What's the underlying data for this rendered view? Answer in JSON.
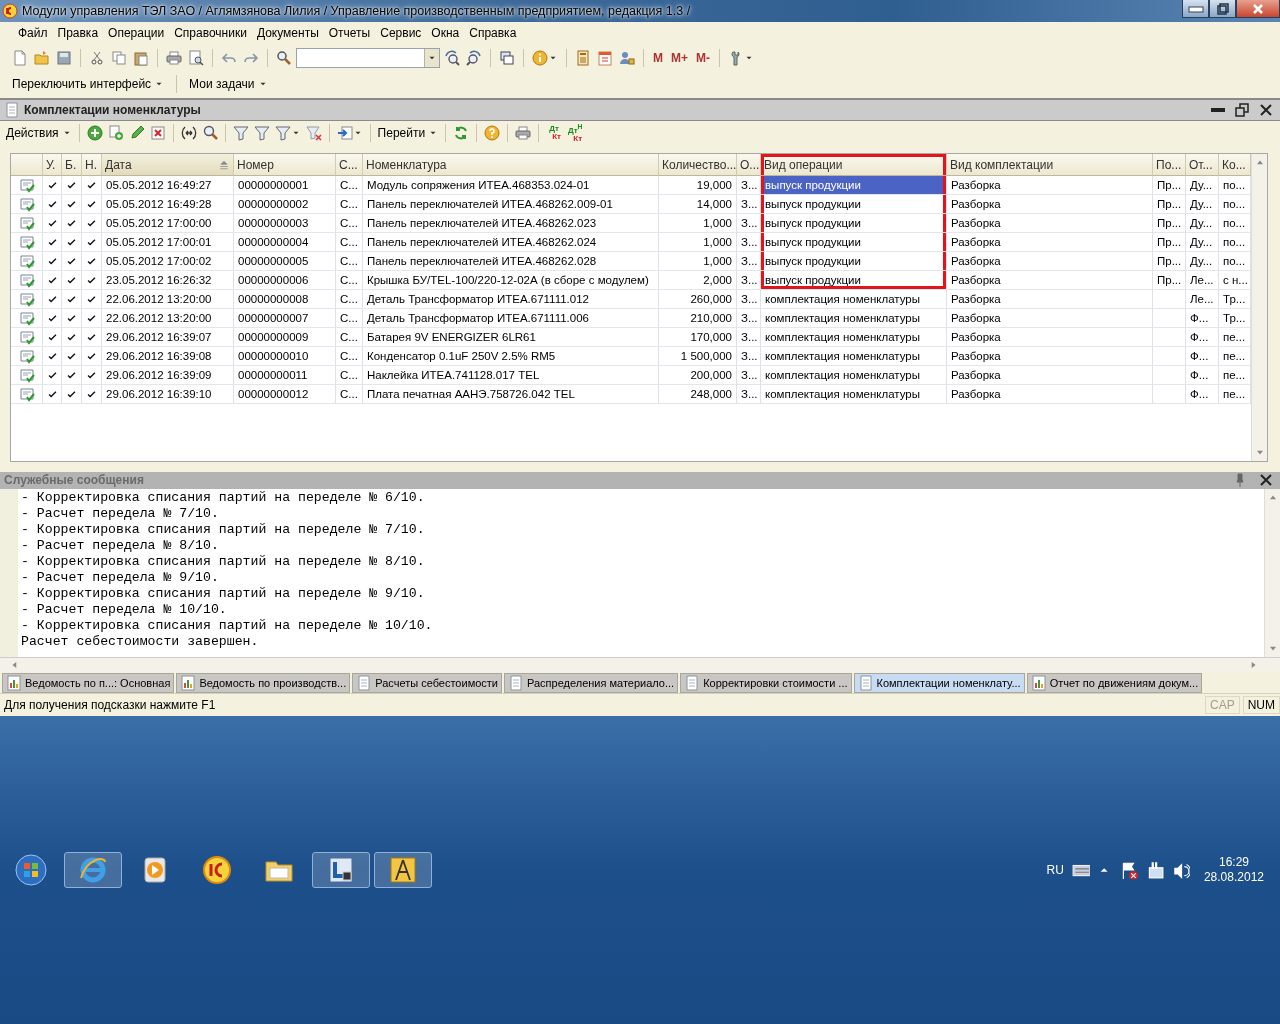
{
  "window": {
    "title": "Модули управления ТЭЛ ЗАО / Аглямзянова Лилия /  Управление производственным предприятием, редакция 1.3 /"
  },
  "menu": [
    "Файл",
    "Правка",
    "Операции",
    "Справочники",
    "Документы",
    "Отчеты",
    "Сервис",
    "Окна",
    "Справка"
  ],
  "toolbar": {
    "memory_buttons": [
      "M",
      "M+",
      "M-"
    ]
  },
  "panel_bar": [
    {
      "label": "Переключить интерфейс",
      "dropdown": true
    },
    {
      "label": "Мои задачи",
      "dropdown": true
    }
  ],
  "document": {
    "title": "Комплектации номенклатуры",
    "actions": "Действия",
    "goto": "Перейти",
    "ledger_buttons": [
      {
        "debit": "Дт",
        "credit": "Кт"
      },
      {
        "debit": "Дт$^{Н}$",
        "credit": "Кт"
      }
    ]
  },
  "table": {
    "check_columns": [
      {
        "label": "У."
      },
      {
        "label": "Б."
      },
      {
        "label": "Н."
      }
    ],
    "columns": [
      {
        "label": "Дата",
        "kind": "text",
        "sorted": true,
        "current": false,
        "framed": false
      },
      {
        "label": "Номер",
        "kind": "text",
        "sorted": false,
        "current": false,
        "framed": false
      },
      {
        "label": "С...",
        "kind": "text",
        "sorted": false,
        "current": false,
        "framed": false
      },
      {
        "label": "Номенклатура",
        "kind": "text",
        "sorted": false,
        "current": false,
        "framed": false
      },
      {
        "label": "Количество...",
        "kind": "number",
        "sorted": false,
        "current": false,
        "framed": false
      },
      {
        "label": "О...",
        "kind": "text",
        "sorted": false,
        "current": false,
        "framed": false
      },
      {
        "label": "Вид операции",
        "kind": "text",
        "sorted": false,
        "current": true,
        "framed": true
      },
      {
        "label": "Вид комплектации",
        "kind": "text",
        "sorted": false,
        "current": false,
        "framed": false
      },
      {
        "label": "По...",
        "kind": "text",
        "sorted": false,
        "current": false,
        "framed": false
      },
      {
        "label": "От...",
        "kind": "text",
        "sorted": false,
        "current": false,
        "framed": false
      },
      {
        "label": "Ко...",
        "kind": "text",
        "sorted": false,
        "current": false,
        "framed": false
      }
    ],
    "rows": [
      {
        "posted": true,
        "selected": true,
        "framed": true,
        "checks": [
          true,
          true,
          true
        ],
        "cells": [
          "05.05.2012 16:49:27",
          "00000000001",
          "С...",
          "Модуль сопряжения ИТЕА.468353.024-01",
          "19,000",
          "З...",
          "выпуск продукции",
          "Разборка",
          "Пр...",
          "Ду...",
          "по..."
        ]
      },
      {
        "posted": true,
        "selected": false,
        "framed": true,
        "checks": [
          true,
          true,
          true
        ],
        "cells": [
          "05.05.2012 16:49:28",
          "00000000002",
          "С...",
          "Панель переключателей ИТЕА.468262.009-01",
          "14,000",
          "З...",
          "выпуск продукции",
          "Разборка",
          "Пр...",
          "Ду...",
          "по..."
        ]
      },
      {
        "posted": true,
        "selected": false,
        "framed": true,
        "checks": [
          true,
          true,
          true
        ],
        "cells": [
          "05.05.2012 17:00:00",
          "00000000003",
          "С...",
          "Панель переключателей ИТЕА.468262.023",
          "1,000",
          "З...",
          "выпуск продукции",
          "Разборка",
          "Пр...",
          "Ду...",
          "по..."
        ]
      },
      {
        "posted": true,
        "selected": false,
        "framed": true,
        "checks": [
          true,
          true,
          true
        ],
        "cells": [
          "05.05.2012 17:00:01",
          "00000000004",
          "С...",
          "Панель переключателей ИТЕА.468262.024",
          "1,000",
          "З...",
          "выпуск продукции",
          "Разборка",
          "Пр...",
          "Ду...",
          "по..."
        ]
      },
      {
        "posted": true,
        "selected": false,
        "framed": true,
        "checks": [
          true,
          true,
          true
        ],
        "cells": [
          "05.05.2012 17:00:02",
          "00000000005",
          "С...",
          "Панель переключателей ИТЕА.468262.028",
          "1,000",
          "З...",
          "выпуск продукции",
          "Разборка",
          "Пр...",
          "Ду...",
          "по..."
        ]
      },
      {
        "posted": true,
        "selected": false,
        "framed": true,
        "checks": [
          true,
          true,
          true
        ],
        "cells": [
          "23.05.2012 16:26:32",
          "00000000006",
          "С...",
          "Крышка БУ/TEL-100/220-12-02А (в сборе с модулем)",
          "2,000",
          "З...",
          "выпуск продукции",
          "Разборка",
          "Пр...",
          "Ле...",
          "с н..."
        ]
      },
      {
        "posted": true,
        "selected": false,
        "framed": false,
        "checks": [
          true,
          true,
          true
        ],
        "cells": [
          "22.06.2012 13:20:00",
          "00000000008",
          "С...",
          "Деталь Трансформатор ИТЕА.671111.012",
          "260,000",
          "З...",
          "комплектация номенклатуры",
          "Разборка",
          null,
          "Ле...",
          "Тр..."
        ]
      },
      {
        "posted": true,
        "selected": false,
        "framed": false,
        "checks": [
          true,
          true,
          true
        ],
        "cells": [
          "22.06.2012 13:20:00",
          "00000000007",
          "С...",
          "Деталь Трансформатор ИТЕА.671111.006",
          "210,000",
          "З...",
          "комплектация номенклатуры",
          "Разборка",
          null,
          "Ф...",
          "Тр..."
        ]
      },
      {
        "posted": true,
        "selected": false,
        "framed": false,
        "checks": [
          true,
          true,
          true
        ],
        "cells": [
          "29.06.2012 16:39:07",
          "00000000009",
          "С...",
          "Батарея 9V ENERGIZER 6LR61",
          "170,000",
          "З...",
          "комплектация номенклатуры",
          "Разборка",
          null,
          "Ф...",
          "пе..."
        ]
      },
      {
        "posted": true,
        "selected": false,
        "framed": false,
        "checks": [
          true,
          true,
          true
        ],
        "cells": [
          "29.06.2012 16:39:08",
          "00000000010",
          "С...",
          "Конденсатор 0.1uF 250V 2.5% RM5",
          "1 500,000",
          "З...",
          "комплектация номенклатуры",
          "Разборка",
          null,
          "Ф...",
          "пе..."
        ]
      },
      {
        "posted": true,
        "selected": false,
        "framed": false,
        "checks": [
          true,
          true,
          true
        ],
        "cells": [
          "29.06.2012 16:39:09",
          "00000000011",
          "С...",
          "Наклейка ИТЕА.741128.017 TEL",
          "200,000",
          "З...",
          "комплектация номенклатуры",
          "Разборка",
          null,
          "Ф...",
          "пе..."
        ]
      },
      {
        "posted": true,
        "selected": false,
        "framed": false,
        "checks": [
          true,
          true,
          true
        ],
        "cells": [
          "29.06.2012 16:39:10",
          "00000000012",
          "С...",
          "Плата печатная ААНЭ.758726.042 TEL",
          "248,000",
          "З...",
          "комплектация номенклатуры",
          "Разборка",
          null,
          "Ф...",
          "пе..."
        ]
      }
    ]
  },
  "messages": {
    "title": "Служебные сообщения",
    "lines": [
      "- Корректировка списания партий на переделе № 6/10.",
      "- Расчет передела № 7/10.",
      "- Корректировка списания партий на переделе № 7/10.",
      "- Расчет передела № 8/10.",
      "- Корректировка списания партий на переделе № 8/10.",
      "- Расчет передела № 9/10.",
      "- Корректировка списания партий на переделе № 9/10.",
      "- Расчет передела № 10/10.",
      "- Корректировка списания партий на переделе № 10/10.",
      "Расчет себестоимости завершен."
    ]
  },
  "window_tabs": [
    {
      "label": "Ведомость по п...: Основная",
      "kind": "report",
      "selected": false
    },
    {
      "label": "Ведомость по производств...",
      "kind": "report",
      "selected": false
    },
    {
      "label": "Расчеты себестоимости",
      "kind": "document",
      "selected": false
    },
    {
      "label": "Распределения материало...",
      "kind": "document",
      "selected": false
    },
    {
      "label": "Корректировки стоимости ...",
      "kind": "document",
      "selected": false
    },
    {
      "label": "Комплектации номенклату...",
      "kind": "document",
      "selected": true
    },
    {
      "label": "Отчет по движениям докум...",
      "kind": "report",
      "selected": false
    }
  ],
  "status_bar": {
    "hint": "Для получения подсказки нажмите F1",
    "indicators": [
      {
        "label": "CAP",
        "on": false
      },
      {
        "label": "NUM",
        "on": true
      }
    ]
  },
  "taskbar": {
    "language": "RU",
    "time": "16:29",
    "date": "28.08.2012"
  }
}
